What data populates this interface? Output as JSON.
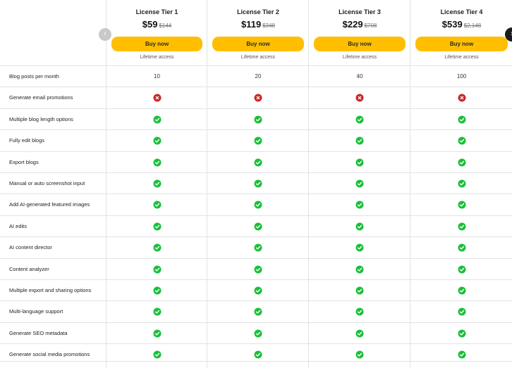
{
  "tiers": [
    {
      "name": "License Tier 1",
      "price": "$59",
      "old_price": "$144",
      "buy_label": "Buy now",
      "access": "Lifetime access"
    },
    {
      "name": "License Tier 2",
      "price": "$119",
      "old_price": "$348",
      "buy_label": "Buy now",
      "access": "Lifetime access"
    },
    {
      "name": "License Tier 3",
      "price": "$229",
      "old_price": "$708",
      "buy_label": "Buy now",
      "access": "Lifetime access"
    },
    {
      "name": "License Tier 4",
      "price": "$539",
      "old_price": "$2,148",
      "buy_label": "Buy now",
      "access": "Lifetime access"
    }
  ],
  "nav": {
    "prev_icon": "chevron-left-icon",
    "next_icon": "chevron-right-icon"
  },
  "colors": {
    "check": "#1bbf3a",
    "cross": "#c62828",
    "button": "#ffbf00",
    "nav_prev": "#c9c9c9",
    "nav_next": "#1c1c1c"
  },
  "features": [
    {
      "label": "Blog posts per month",
      "values": [
        "10",
        "20",
        "40",
        "100"
      ]
    },
    {
      "label": "Generate email promotions",
      "values": [
        "cross",
        "cross",
        "cross",
        "cross"
      ]
    },
    {
      "label": "Multiple blog length options",
      "values": [
        "check",
        "check",
        "check",
        "check"
      ]
    },
    {
      "label": "Fully edit blogs",
      "values": [
        "check",
        "check",
        "check",
        "check"
      ]
    },
    {
      "label": "Export blogs",
      "values": [
        "check",
        "check",
        "check",
        "check"
      ]
    },
    {
      "label": "Manual or auto screenshot input",
      "values": [
        "check",
        "check",
        "check",
        "check"
      ]
    },
    {
      "label": "Add AI-generated featured images",
      "values": [
        "check",
        "check",
        "check",
        "check"
      ]
    },
    {
      "label": "AI edits",
      "values": [
        "check",
        "check",
        "check",
        "check"
      ]
    },
    {
      "label": "AI content director",
      "values": [
        "check",
        "check",
        "check",
        "check"
      ]
    },
    {
      "label": "Content analyzer",
      "values": [
        "check",
        "check",
        "check",
        "check"
      ]
    },
    {
      "label": "Multiple export and sharing options",
      "values": [
        "check",
        "check",
        "check",
        "check"
      ]
    },
    {
      "label": "Multi-language support",
      "values": [
        "check",
        "check",
        "check",
        "check"
      ]
    },
    {
      "label": "Generate SEO metadata",
      "values": [
        "check",
        "check",
        "check",
        "check"
      ]
    },
    {
      "label": "Generate social media promotions",
      "values": [
        "check",
        "check",
        "check",
        "check"
      ]
    }
  ]
}
